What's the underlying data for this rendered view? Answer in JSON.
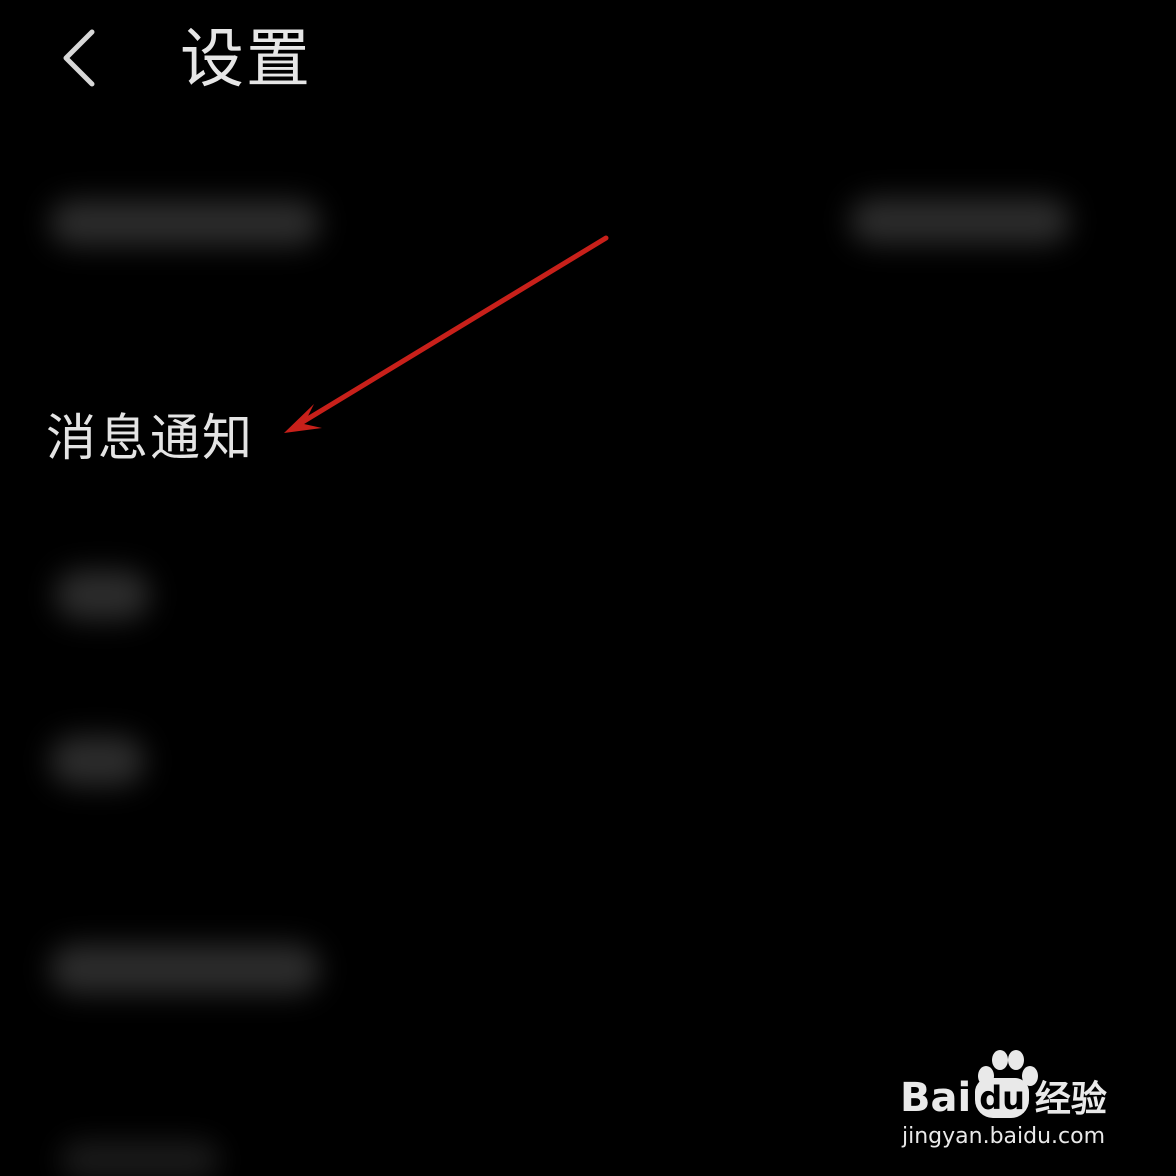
{
  "header": {
    "title": "设置",
    "back_icon": "chevron-left-icon"
  },
  "settings": {
    "items": [
      {
        "label": "消息通知"
      }
    ]
  },
  "annotation": {
    "arrow_color": "#c8201a"
  },
  "watermark": {
    "brand": "Bai",
    "brand_du": "du",
    "brand_cn": "经验",
    "url": "jingyan.baidu.com"
  },
  "colors": {
    "background": "#000000",
    "text": "#e6e6e6"
  }
}
